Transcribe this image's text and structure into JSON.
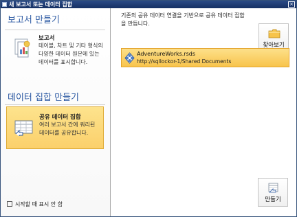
{
  "window": {
    "title": "새 보고서 또는 데이터 집합"
  },
  "sidebar": {
    "create_report_title": "보고서 만들기",
    "report_item": {
      "title": "보고서",
      "description": "테이블, 차트 및 기타 형식의 다양한 데이터 원본에 있는 데이터를 표시합니다."
    },
    "create_dataset_title": "데이터 집합 만들기",
    "shared_dataset_item": {
      "title": "공유 데이터 집합",
      "description": "여러 보고서 간에 쿼리된 데이터를 공유합니다."
    },
    "startup_checkbox_label": "시작할 때 표시 안 함"
  },
  "main": {
    "instruction": "기존의 공유 데이터 연결을 기반으로 공유 데이터 집합을 만듭니다.",
    "browse_button": "찾아보기",
    "data_source": {
      "name": "AdventureWorks.rsds",
      "path": "http://sqllockor-1/Shared Documents"
    },
    "create_button": "만들기"
  }
}
